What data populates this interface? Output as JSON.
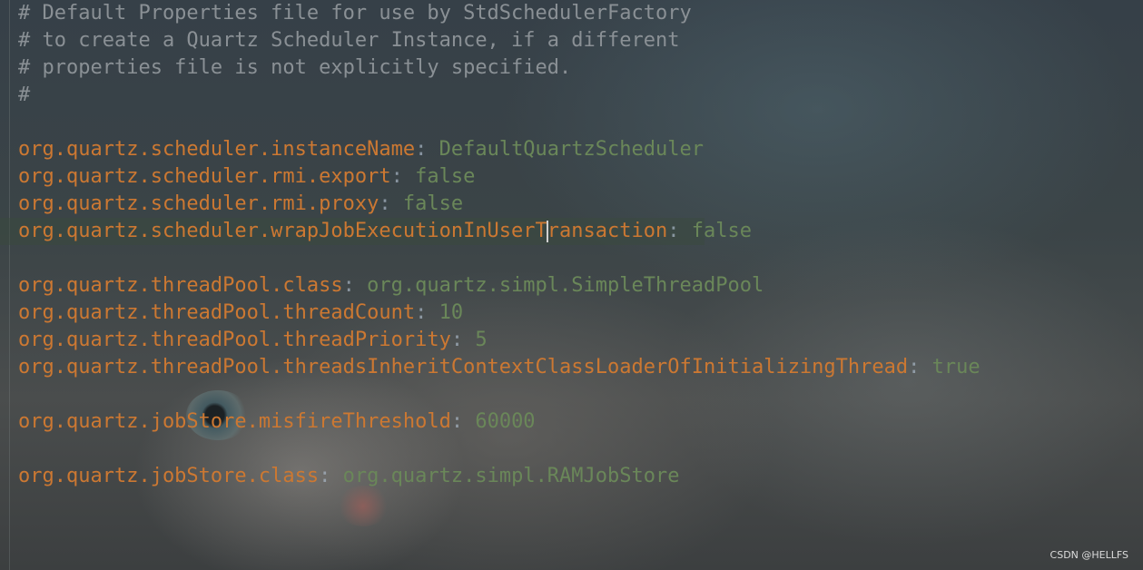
{
  "comments": [
    "# Default Properties file for use by StdSchedulerFactory",
    "# to create a Quartz Scheduler Instance, if a different",
    "# properties file is not explicitly specified.",
    "#"
  ],
  "properties": {
    "instance_name": {
      "key": "org.quartz.scheduler.instanceName",
      "value": "DefaultQuartzScheduler"
    },
    "rmi_export": {
      "key": "org.quartz.scheduler.rmi.export",
      "value": "false"
    },
    "rmi_proxy": {
      "key": "org.quartz.scheduler.rmi.proxy",
      "value": "false"
    },
    "wrap_job": {
      "key_before_caret": "org.quartz.scheduler.wrapJobExecutionInUserT",
      "key_after_caret": "ransaction",
      "value": "false"
    },
    "thread_pool_class": {
      "key": "org.quartz.threadPool.class",
      "value": "org.quartz.simpl.SimpleThreadPool"
    },
    "thread_count": {
      "key": "org.quartz.threadPool.threadCount",
      "value": "10"
    },
    "thread_priority": {
      "key": "org.quartz.threadPool.threadPriority",
      "value": "5"
    },
    "threads_inherit": {
      "key": "org.quartz.threadPool.threadsInheritContextClassLoaderOfInitializingThread",
      "value": "true"
    },
    "misfire_threshold": {
      "key": "org.quartz.jobStore.misfireThreshold",
      "value": "60000"
    },
    "job_store_class": {
      "key": "org.quartz.jobStore.class",
      "value": "org.quartz.simpl.RAMJobStore"
    }
  },
  "separator": ": ",
  "watermark": "CSDN @HELLFS",
  "colors": {
    "key": "#cc7832",
    "value": "#6a8759",
    "comment": "#8a9095"
  }
}
